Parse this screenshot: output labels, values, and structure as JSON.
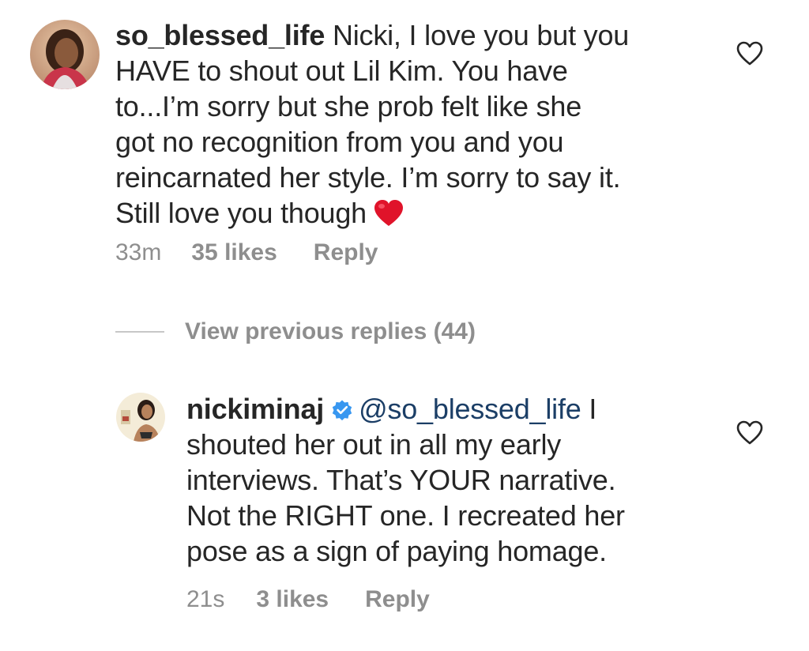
{
  "comments": [
    {
      "username": "so_blessed_life",
      "text_lines": [
        " Nicki, I love you but you",
        "HAVE to shout out Lil Kim. You have",
        "to...I’m sorry but she prob felt like she",
        "got no recognition from you and you",
        "reincarnated her style. I’m sorry to say it.",
        "Still love you though"
      ],
      "emoji": "red-heart-emoji",
      "time": "33m",
      "likes": "35 likes",
      "reply_label": "Reply"
    },
    {
      "username": "nickiminaj",
      "verified": true,
      "mention": "@so_blessed_life",
      "text_lines": [
        " I",
        "shouted her out in all my early",
        "interviews. That’s YOUR narrative.",
        "Not the RIGHT one. I recreated her",
        "pose as a sign of paying homage."
      ],
      "time": "21s",
      "likes": "3 likes",
      "reply_label": "Reply"
    }
  ],
  "view_previous": {
    "label": "View previous replies (44)"
  },
  "icons": {
    "like": "heart-outline-icon",
    "verified": "verified-badge-icon"
  },
  "colors": {
    "text": "#262626",
    "meta": "#8e8e8e",
    "mention": "#1b3e66",
    "verified": "#3897f0",
    "emoji_heart": "#e0132a"
  }
}
